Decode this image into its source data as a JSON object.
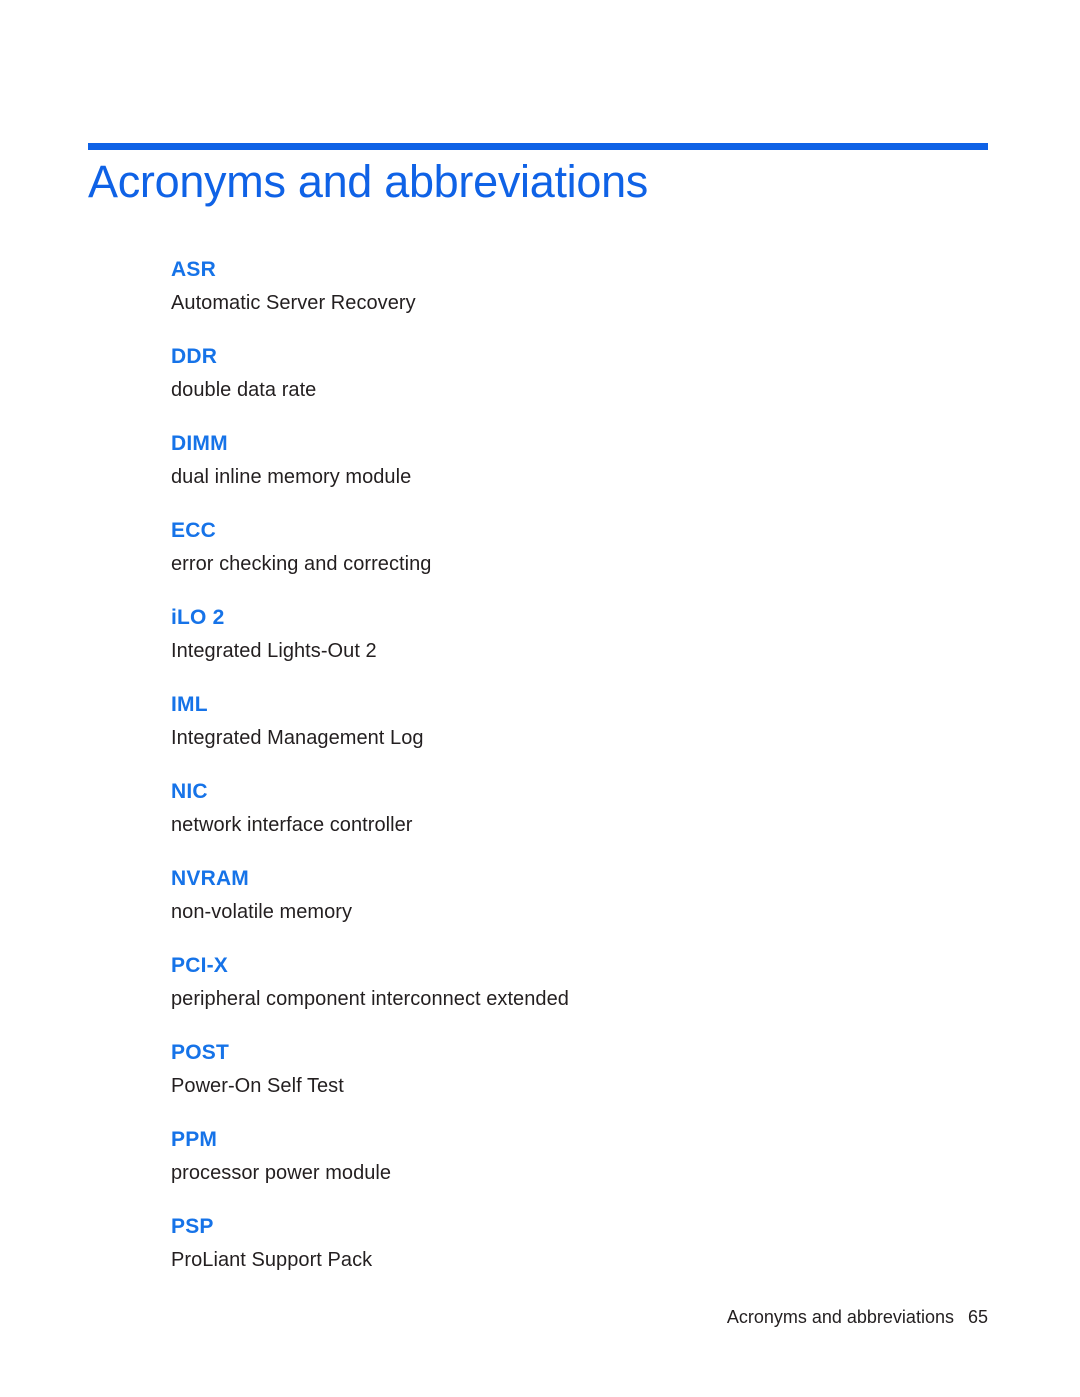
{
  "document": {
    "title": "Acronyms and abbreviations",
    "accent_color": "#0f62e6",
    "term_color": "#1673e8",
    "text_color": "#231f20",
    "background_color": "#ffffff"
  },
  "entries": [
    {
      "term": "ASR",
      "definition": "Automatic Server Recovery"
    },
    {
      "term": "DDR",
      "definition": "double data rate"
    },
    {
      "term": "DIMM",
      "definition": "dual inline memory module"
    },
    {
      "term": "ECC",
      "definition": "error checking and correcting"
    },
    {
      "term": "iLO 2",
      "definition": "Integrated Lights-Out 2"
    },
    {
      "term": "IML",
      "definition": "Integrated Management Log"
    },
    {
      "term": "NIC",
      "definition": "network interface controller"
    },
    {
      "term": "NVRAM",
      "definition": "non-volatile memory"
    },
    {
      "term": "PCI-X",
      "definition": "peripheral component interconnect extended"
    },
    {
      "term": "POST",
      "definition": "Power-On Self Test"
    },
    {
      "term": "PPM",
      "definition": "processor power module"
    },
    {
      "term": "PSP",
      "definition": "ProLiant Support Pack"
    }
  ],
  "footer": {
    "label": "Acronyms and abbreviations",
    "page_number": "65"
  }
}
